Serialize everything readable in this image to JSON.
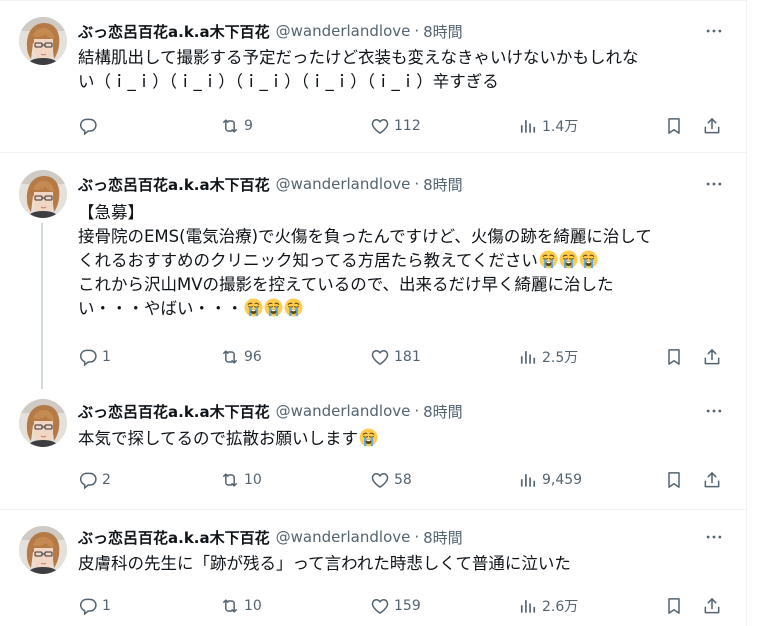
{
  "colors": {
    "text_primary": "#0f1419",
    "text_secondary": "#536471",
    "divider": "#eff3f4",
    "thread_line": "#cfd9de"
  },
  "tweets": [
    {
      "display_name": "ぶっ恋呂百花a.k.a木下百花",
      "handle": "@wanderlandlove",
      "separator": "·",
      "time": "8時間",
      "lines": [
        "結構肌出して撮影する予定だったけど衣装も変えなきゃいけないかもしれな",
        "い（ｉ_ｉ）（ｉ_ｉ）（ｉ_ｉ）（ｉ_ｉ）（ｉ_ｉ）辛すぎる"
      ],
      "replies": "",
      "retweets": "9",
      "likes": "112",
      "views": "1.4万"
    },
    {
      "display_name": "ぶっ恋呂百花a.k.a木下百花",
      "handle": "@wanderlandlove",
      "separator": "·",
      "time": "8時間",
      "lines": [
        "【急募】",
        "接骨院のEMS(電気治療)で火傷を負ったんですけど、火傷の跡を綺麗に治して",
        "くれるおすすめのクリニック知ってる方居たら教えてください",
        "これから沢山MVの撮影を控えているので、出来るだけ早く綺麗に治した",
        "い・・・やばい・・・"
      ],
      "replies": "1",
      "retweets": "96",
      "likes": "181",
      "views": "2.5万"
    },
    {
      "display_name": "ぶっ恋呂百花a.k.a木下百花",
      "handle": "@wanderlandlove",
      "separator": "·",
      "time": "8時間",
      "lines": [
        "本気で探してるので拡散お願いします"
      ],
      "replies": "2",
      "retweets": "10",
      "likes": "58",
      "views": "9,459"
    },
    {
      "display_name": "ぶっ恋呂百花a.k.a木下百花",
      "handle": "@wanderlandlove",
      "separator": "·",
      "time": "8時間",
      "lines": [
        "皮膚科の先生に「跡が残る」って言われた時悲しくて普通に泣いた"
      ],
      "replies": "1",
      "retweets": "10",
      "likes": "159",
      "views": "2.6万"
    }
  ],
  "icons": {
    "more": "more-horizontal-icon",
    "reply": "reply-icon",
    "retweet": "retweet-icon",
    "like": "heart-icon",
    "views": "views-icon",
    "bookmark": "bookmark-icon",
    "share": "share-icon",
    "emoji": "loudly-crying-face-emoji"
  }
}
